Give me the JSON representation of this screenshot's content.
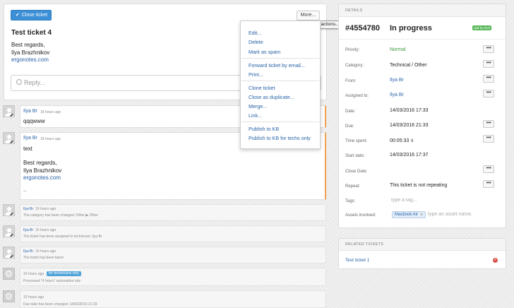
{
  "toolbar": {
    "close_label": "Close ticket",
    "more_label": "More...",
    "more_tooltip": "More actions..."
  },
  "ticket": {
    "title": "Test ticket 4",
    "body_line1": "Best regards,",
    "body_line2": "Ilya Brazhnikov",
    "body_link": "ergonotes.com",
    "reply_placeholder": "Reply..."
  },
  "menu": {
    "items": [
      "Edit...",
      "Delete",
      "Mark as spam",
      "Forward ticket by email...",
      "Print...",
      "Clone ticket",
      "Close as duplicate...",
      "Merge...",
      "Link...",
      "Publish to KB",
      "Publish to KB for techs only"
    ]
  },
  "comments": [
    {
      "author": "Ilya Br",
      "time": "18 hours ago",
      "text": "qqqwww"
    },
    {
      "author": "Ilya Br",
      "time": "18 hours ago",
      "text": "text",
      "sig1": "Best regards,",
      "sig2": "Ilya Brazhnikov",
      "link": "ergonotes.com",
      "ellipsis": ".."
    }
  ],
  "events": [
    {
      "author": "Ilya Br",
      "time": "19 hours ago",
      "text": "The category has been changed: Other ▶ Other"
    },
    {
      "author": "Ilya Br",
      "time": "19 hours ago",
      "text": "The ticket has been assigned to technician: Ilya Br"
    },
    {
      "author": "Ilya Br",
      "time": "19 hours ago",
      "text": "The ticket has been taken"
    },
    {
      "time": "19 hours ago",
      "badge": "for technicians only",
      "text": "Processed \"4 hours\" automation rule"
    },
    {
      "time": "19 hours ago",
      "text": "Due date has been changed: 14/03/2016 21:33"
    }
  ],
  "details": {
    "header": "DETAILS",
    "ticket_id": "#4554780",
    "status": "In progress",
    "badge": "opd by tech",
    "rows": [
      {
        "label": "Priority:",
        "value": "Normal"
      },
      {
        "label": "Category:",
        "value": "Technical / Other"
      },
      {
        "label": "From:",
        "value": "Ilya Br"
      },
      {
        "label": "Assigned to:",
        "value": "Ilya Br"
      },
      {
        "label": "Date:",
        "value": "14/03/2016 17:33"
      },
      {
        "label": "Due:",
        "value": "14/03/2016 21:33"
      },
      {
        "label": "Time spent:",
        "value": "00:05:33 ॥"
      },
      {
        "label": "Start date:",
        "value": "14/03/2016 17:37"
      },
      {
        "label": "Close Date:",
        "value": ""
      },
      {
        "label": "Repeat:",
        "value": "This ticket is not repeating"
      },
      {
        "label": "Tags:",
        "value": ""
      },
      {
        "label": "Assets involved:",
        "value": ""
      }
    ],
    "tags_placeholder": "type a tag...",
    "asset_chip": "Macbook Air",
    "asset_chip_close": "x",
    "asset_placeholder": "type an asset name.",
    "dots": "•••"
  },
  "related": {
    "header": "RELATED TICKETS",
    "items": [
      "Test ticket 1"
    ]
  },
  "colors": {
    "accent": "#3b8fd6",
    "link": "#2a63a8",
    "priority": "#3c9a3c",
    "badge": "#5cb85c",
    "remove": "#d9534f"
  }
}
